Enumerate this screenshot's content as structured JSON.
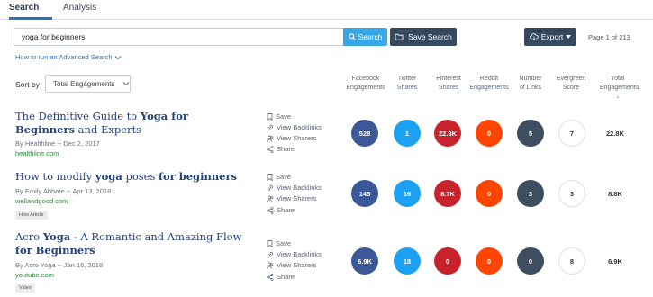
{
  "tabs": [
    {
      "label": "Search",
      "active": true
    },
    {
      "label": "Analysis",
      "active": false
    }
  ],
  "search": {
    "value": "yoga for beginners",
    "button_label": "Search"
  },
  "save_search_label": "Save Search",
  "export_label": "Export",
  "page_counter": "Page 1 of 213",
  "advanced_search_link": "How to run an Advanced Search",
  "sort": {
    "label": "Sort by",
    "selected": "Total Engagements"
  },
  "columns": [
    "Facebook Engagements",
    "Twitter Shares",
    "Pinterest Shares",
    "Reddit Engagements",
    "Number of Links",
    "Evergreen Score",
    "Total Engagements"
  ],
  "actions": {
    "save": "Save",
    "backlinks": "View Backlinks",
    "sharers": "View Sharers",
    "share": "Share"
  },
  "colors": {
    "facebook": "#3b5998",
    "twitter": "#1da1f2",
    "pinterest": "#c8232c",
    "reddit": "#ff4500",
    "links": "#3c4e60",
    "accent": "#37a7e6",
    "dark_button": "#34495e",
    "title": "#24427c",
    "domain": "#2e8b3e"
  },
  "results": [
    {
      "title_parts": [
        {
          "t": "The Definitive Guide to ",
          "b": false
        },
        {
          "t": "Yoga for Beginners",
          "b": true
        },
        {
          "t": " and Experts",
          "b": false
        }
      ],
      "byline": "By Healthline -- Dec 2, 2017",
      "domain": "healthline.com",
      "badge": "",
      "facebook": "528",
      "twitter": "1",
      "pinterest": "22.3K",
      "reddit": "0",
      "links": "5",
      "evergreen": "7",
      "total": "22.8K"
    },
    {
      "title_parts": [
        {
          "t": "How to modify ",
          "b": false
        },
        {
          "t": "yoga",
          "b": true
        },
        {
          "t": " poses ",
          "b": false
        },
        {
          "t": "for beginners",
          "b": true
        }
      ],
      "byline": "By Emily Abbate -- Apr 13, 2018",
      "domain": "wellandgood.com",
      "badge": "How Article",
      "facebook": "145",
      "twitter": "16",
      "pinterest": "8.7K",
      "reddit": "0",
      "links": "3",
      "evergreen": "3",
      "total": "8.8K"
    },
    {
      "title_parts": [
        {
          "t": "Acro ",
          "b": false
        },
        {
          "t": "Yoga",
          "b": true
        },
        {
          "t": " - A Romantic and Amazing Flow ",
          "b": false
        },
        {
          "t": "for Beginners",
          "b": true
        }
      ],
      "byline": "By Acro Yoga -- Jan 16, 2018",
      "domain": "youtube.com",
      "badge": "Video",
      "facebook": "6.9K",
      "twitter": "18",
      "pinterest": "0",
      "reddit": "0",
      "links": "0",
      "evergreen": "8",
      "total": "6.9K"
    }
  ]
}
